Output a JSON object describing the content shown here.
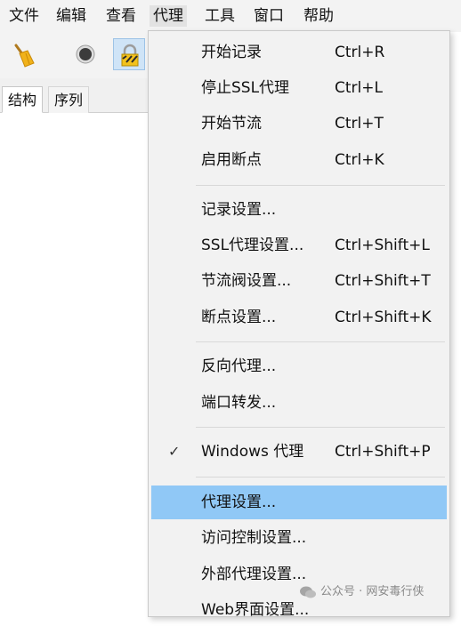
{
  "menubar": {
    "items": [
      "文件",
      "编辑",
      "查看",
      "代理",
      "工具",
      "窗口",
      "帮助"
    ]
  },
  "toolbar": {
    "buttons": [
      "broom-icon",
      "record-icon",
      "lock-icon"
    ]
  },
  "tabs": [
    "结构",
    "序列"
  ],
  "dropdown": {
    "items": [
      {
        "label": "开始记录",
        "shortcut": "Ctrl+R"
      },
      {
        "label": "停止SSL代理",
        "shortcut": "Ctrl+L"
      },
      {
        "label": "开始节流",
        "shortcut": "Ctrl+T"
      },
      {
        "label": "启用断点",
        "shortcut": "Ctrl+K"
      },
      {
        "label": "记录设置...",
        "shortcut": ""
      },
      {
        "label": "SSL代理设置...",
        "shortcut": "Ctrl+Shift+L"
      },
      {
        "label": "节流阀设置...",
        "shortcut": "Ctrl+Shift+T"
      },
      {
        "label": "断点设置...",
        "shortcut": "Ctrl+Shift+K"
      },
      {
        "label": "反向代理...",
        "shortcut": ""
      },
      {
        "label": "端口转发...",
        "shortcut": ""
      },
      {
        "label": "Windows 代理",
        "shortcut": "Ctrl+Shift+P",
        "checked": true,
        "check_mark": "✓"
      },
      {
        "label": "代理设置...",
        "shortcut": "",
        "highlighted": true
      },
      {
        "label": "访问控制设置...",
        "shortcut": ""
      },
      {
        "label": "外部代理设置...",
        "shortcut": ""
      },
      {
        "label": "Web界面设置...",
        "shortcut": ""
      }
    ]
  },
  "watermark": {
    "text": "公众号 · 网安毒行侠"
  },
  "colors": {
    "highlight": "#90c8f6",
    "menu_bg": "#f2f2f2",
    "pressed_button": "#cfe4f7"
  }
}
